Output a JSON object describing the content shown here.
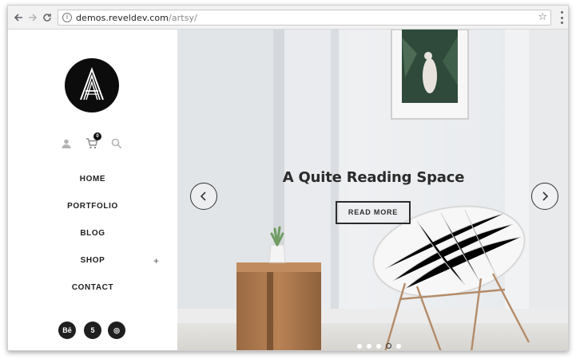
{
  "browser": {
    "url_host": "demos.reveldev.com",
    "url_path": "/artsy/",
    "icons": [
      "back-arrow-icon",
      "forward-arrow-icon",
      "reload-icon",
      "info-icon",
      "star-icon",
      "kebab-menu-icon"
    ]
  },
  "sidebar": {
    "logo_letter": "A",
    "cart_count": "0",
    "menu": [
      {
        "label": "HOME"
      },
      {
        "label": "PORTFOLIO"
      },
      {
        "label": "BLOG"
      },
      {
        "label": "SHOP",
        "has_submenu": true,
        "expander": "+"
      },
      {
        "label": "CONTACT"
      }
    ],
    "social": [
      {
        "icon": "behance-icon",
        "text": "Bē"
      },
      {
        "icon": "fivehundredpx-icon",
        "text": "5"
      },
      {
        "icon": "dribbble-icon",
        "text": "◎"
      }
    ]
  },
  "hero": {
    "title": "A Quite Reading Space",
    "button_label": "READ MORE",
    "slide_count": 5,
    "active_slide": 4
  },
  "colors": {
    "accent": "#1e1e1e",
    "hero_bg": "#e9ecef",
    "wood": "#b27a4e"
  }
}
